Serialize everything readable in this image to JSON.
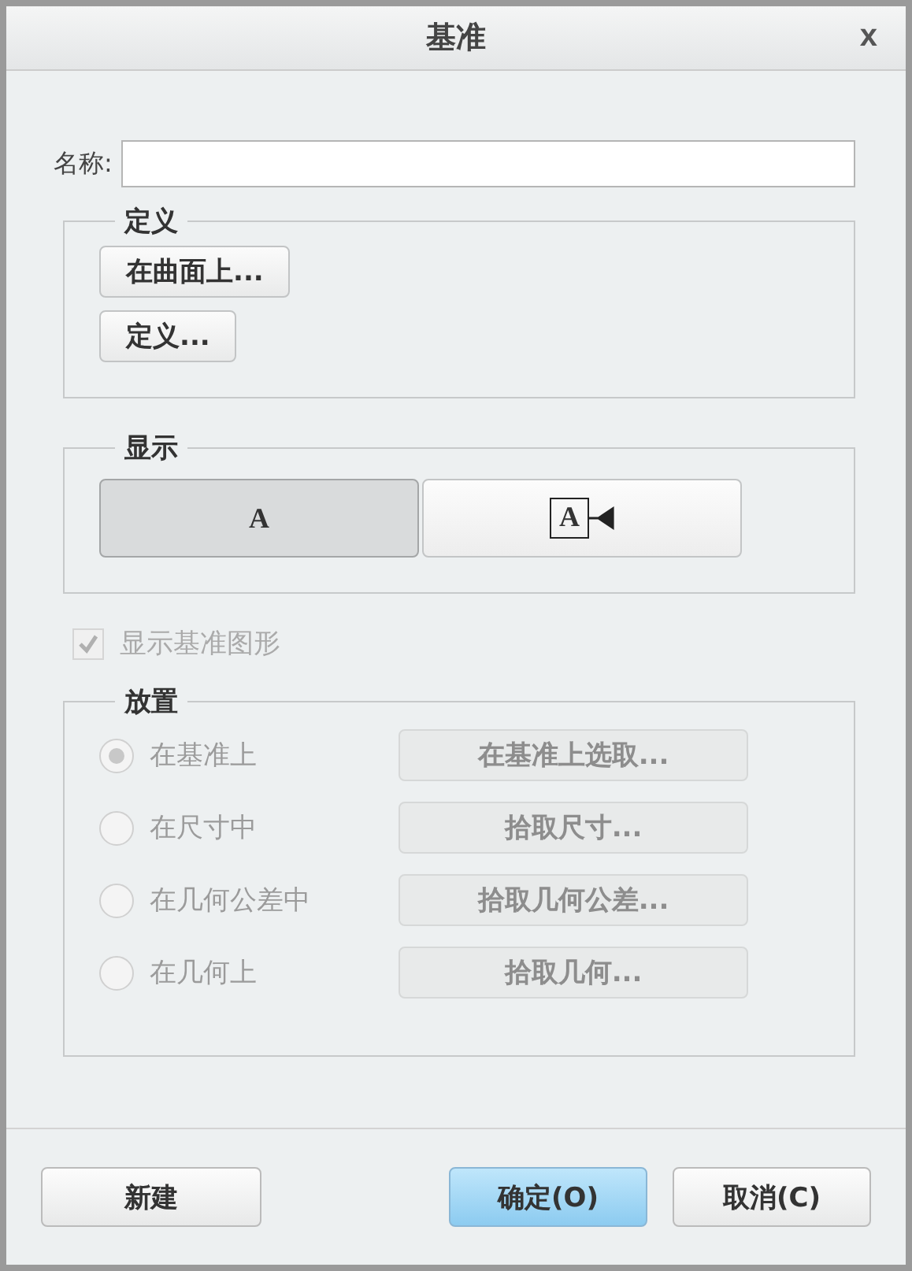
{
  "window": {
    "title": "基准",
    "close": "x"
  },
  "name_field": {
    "label": "名称:"
  },
  "definition": {
    "title": "定义",
    "buttons": [
      "在曲面上...",
      "定义..."
    ]
  },
  "display": {
    "title": "显示",
    "options": [
      {
        "label": "A",
        "kind": "plain",
        "selected": true
      },
      {
        "label": "A",
        "kind": "flag",
        "selected": false
      }
    ]
  },
  "show_datum_graphic": {
    "label": "显示基准图形",
    "checked": true,
    "disabled": true
  },
  "placement": {
    "title": "放置",
    "disabled": true,
    "options": [
      {
        "label": "在基准上",
        "selected": true,
        "button": "在基准上选取..."
      },
      {
        "label": "在尺寸中",
        "selected": false,
        "button": "拾取尺寸..."
      },
      {
        "label": "在几何公差中",
        "selected": false,
        "button": "拾取几何公差..."
      },
      {
        "label": "在几何上",
        "selected": false,
        "button": "拾取几何..."
      }
    ]
  },
  "footer": {
    "buttons": [
      {
        "label": "新建",
        "kind": "normal"
      },
      {
        "label": "确定(O)",
        "kind": "default"
      },
      {
        "label": "取消(C)",
        "kind": "normal"
      }
    ]
  }
}
